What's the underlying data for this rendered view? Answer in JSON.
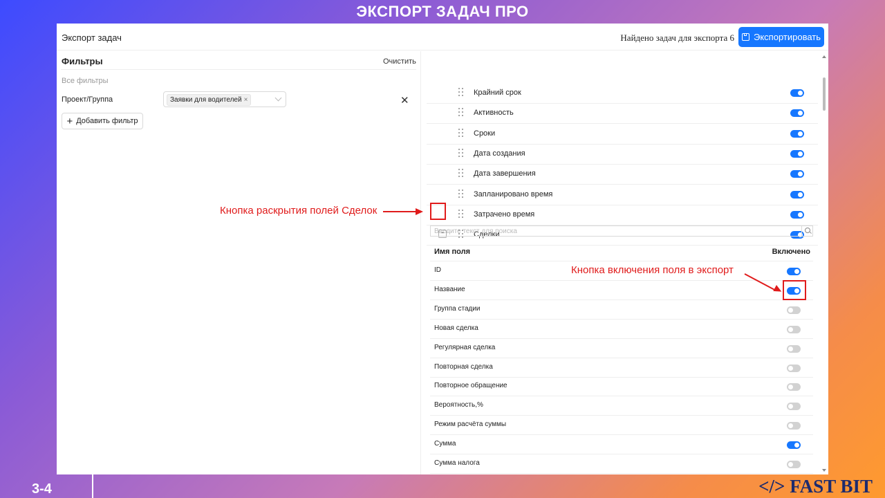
{
  "slide": {
    "title": "ЭКСПОРТ ЗАДАЧ ПРО",
    "page_number": "3-4",
    "brand": "</> FAST BIT"
  },
  "header": {
    "title": "Экспорт задач",
    "found_text": "Найдено задач для экспорта 6",
    "export_label": "Экспортировать",
    "export_icon": "save-icon"
  },
  "filters": {
    "title": "Фильтры",
    "clear_label": "Очистить",
    "all_label": "Все фильтры",
    "project_label": "Проект/Группа",
    "project_tag": "Заявки для водителей",
    "add_label": "Добавить фильтр"
  },
  "fields": [
    {
      "label": "Крайний срок",
      "enabled": true
    },
    {
      "label": "Активность",
      "enabled": true
    },
    {
      "label": "Сроки",
      "enabled": true
    },
    {
      "label": "Дата создания",
      "enabled": true
    },
    {
      "label": "Дата завершения",
      "enabled": true
    },
    {
      "label": "Запланировано время",
      "enabled": true
    },
    {
      "label": "Затрачено время",
      "enabled": true
    },
    {
      "label": "Сделки",
      "enabled": true,
      "expanded": true
    }
  ],
  "collapse_symbol": "−",
  "deals": {
    "search_placeholder": "Введите текст для поиска",
    "col_name": "Имя поля",
    "col_enabled": "Включено",
    "rows": [
      {
        "label": "ID",
        "enabled": true
      },
      {
        "label": "Название",
        "enabled": true
      },
      {
        "label": "Группа стадии",
        "enabled": false
      },
      {
        "label": "Новая сделка",
        "enabled": false
      },
      {
        "label": "Регулярная сделка",
        "enabled": false
      },
      {
        "label": "Повторная сделка",
        "enabled": false
      },
      {
        "label": "Повторное обращение",
        "enabled": false
      },
      {
        "label": "Вероятность,%",
        "enabled": false
      },
      {
        "label": "Режим расчёта суммы",
        "enabled": false
      },
      {
        "label": "Сумма",
        "enabled": true
      },
      {
        "label": "Сумма налога",
        "enabled": false
      }
    ]
  },
  "annotations": {
    "expand_label": "Кнопка раскрытия полей Сделок",
    "toggle_label": "Кнопка включения поля в экспорт"
  },
  "colors": {
    "accent": "#1677ff",
    "annotation": "#e01b1b"
  }
}
